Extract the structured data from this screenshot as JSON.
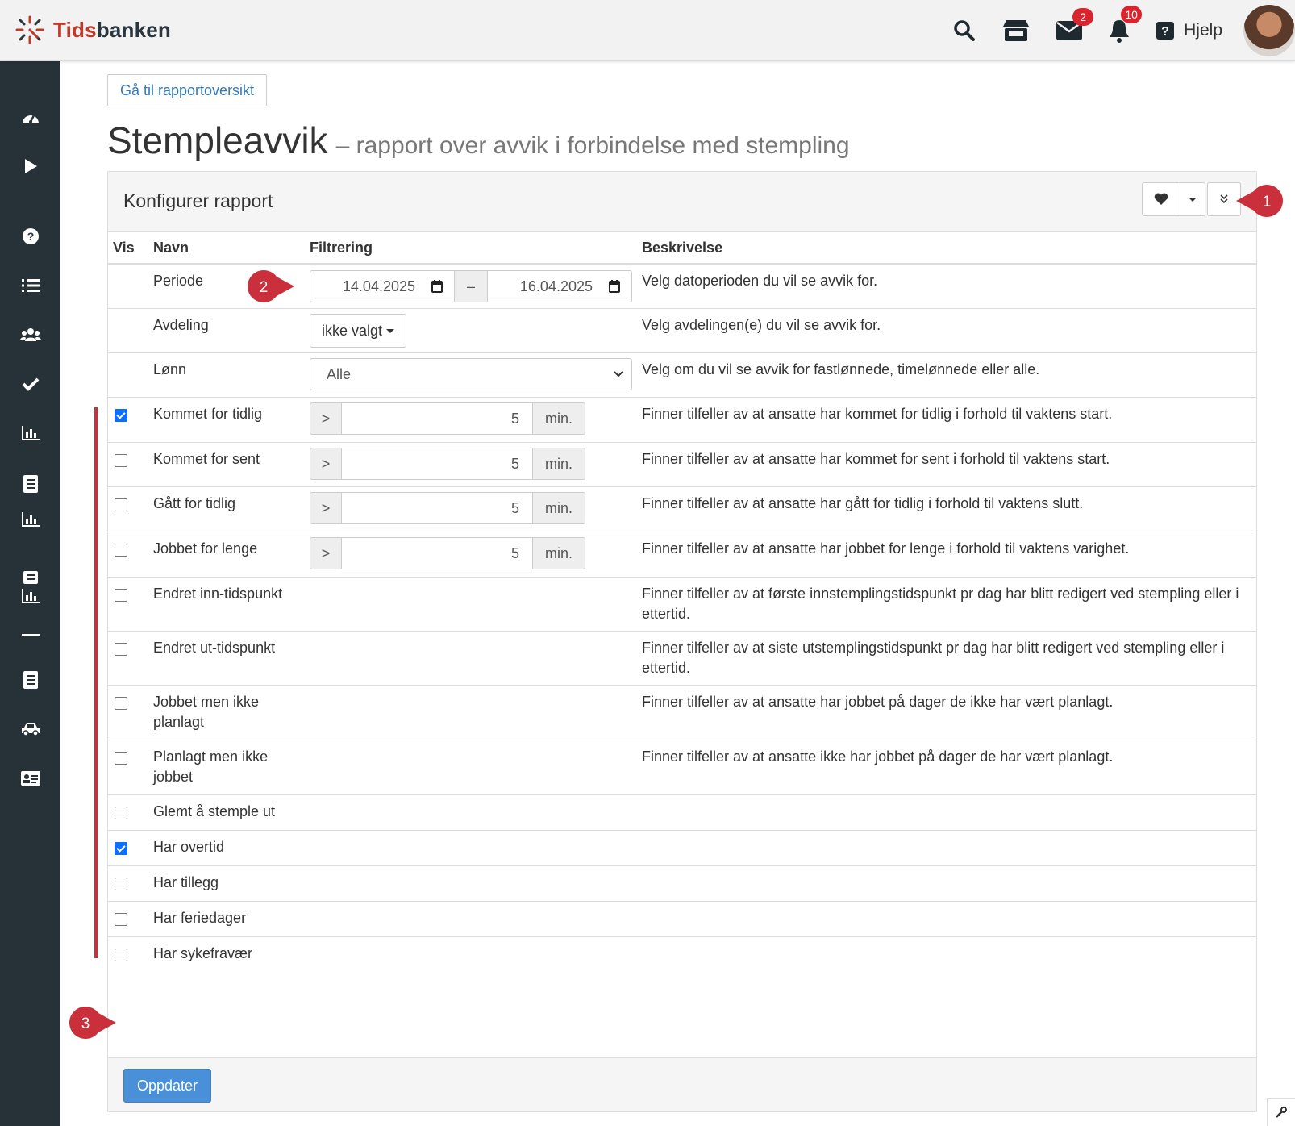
{
  "app": {
    "logo_tids": "Tids",
    "logo_banken": "banken"
  },
  "topbar": {
    "mail_badge": "2",
    "bell_badge": "10",
    "help_label": "Hjelp",
    "icons": [
      "search-icon",
      "store-icon",
      "envelope-icon",
      "bell-icon",
      "question-icon",
      "avatar"
    ]
  },
  "sidebar": {
    "icons": [
      "dashboard-icon",
      "play-icon",
      "question-circle-icon",
      "list-icon",
      "users-icon",
      "check-icon",
      "bar-chart-icon",
      "report-icon",
      "bar-chart-icon",
      "report-chart-icon",
      "minus-icon",
      "report-icon",
      "car-icon",
      "id-card-icon"
    ]
  },
  "main": {
    "back_button": "Gå til rapportoversikt",
    "title": "Stempleavvik",
    "subtitle": "– rapport over avvik i forbindelse med stempling"
  },
  "panel": {
    "title": "Konfigurer rapport",
    "columns": {
      "vis": "Vis",
      "name": "Navn",
      "filter": "Filtrering",
      "desc": "Beskrivelse"
    },
    "periode": {
      "label": "Periode",
      "from": "14.04.2025",
      "sep": "–",
      "to": "16.04.2025",
      "desc": "Velg datoperioden du vil se avvik for."
    },
    "avdeling": {
      "label": "Avdeling",
      "value": "ikke valgt",
      "desc": "Velg avdelingen(e) du vil se avvik for."
    },
    "lonn": {
      "label": "Lønn",
      "value": "Alle",
      "desc": "Velg om du vil se avvik for fastlønnede, timelønnede eller alle."
    },
    "rows": [
      {
        "checked": true,
        "name": "Kommet for tidlig",
        "op": ">",
        "value": "5",
        "unit": "min.",
        "desc": "Finner tilfeller av at ansatte har kommet for tidlig i forhold til vaktens start."
      },
      {
        "checked": false,
        "name": "Kommet for sent",
        "op": ">",
        "value": "5",
        "unit": "min.",
        "desc": "Finner tilfeller av at ansatte har kommet for sent i forhold til vaktens start."
      },
      {
        "checked": false,
        "name": "Gått for tidlig",
        "op": ">",
        "value": "5",
        "unit": "min.",
        "desc": "Finner tilfeller av at ansatte har gått for tidlig i forhold til vaktens slutt."
      },
      {
        "checked": false,
        "name": "Jobbet for lenge",
        "op": ">",
        "value": "5",
        "unit": "min.",
        "desc": "Finner tilfeller av at ansatte har jobbet for lenge i forhold til vaktens varighet."
      },
      {
        "checked": false,
        "name": "Endret inn-tidspunkt",
        "desc": "Finner tilfeller av at første innstemplingstidspunkt pr dag har blitt redigert ved stempling eller i ettertid."
      },
      {
        "checked": false,
        "name": "Endret ut-tidspunkt",
        "desc": "Finner tilfeller av at siste utstemplingstidspunkt pr dag har blitt redigert ved stempling eller i ettertid."
      },
      {
        "checked": false,
        "name": "Jobbet men ikke planlagt",
        "desc": "Finner tilfeller av at ansatte har jobbet på dager de ikke har vært planlagt."
      },
      {
        "checked": false,
        "name": "Planlagt men ikke jobbet",
        "desc": "Finner tilfeller av at ansatte ikke har jobbet på dager de har vært planlagt."
      },
      {
        "checked": false,
        "name": "Glemt å stemple ut",
        "desc": ""
      },
      {
        "checked": true,
        "name": "Har overtid",
        "desc": ""
      },
      {
        "checked": false,
        "name": "Har tillegg",
        "desc": ""
      },
      {
        "checked": false,
        "name": "Har feriedager",
        "desc": ""
      },
      {
        "checked": false,
        "name": "Har sykefravær",
        "desc": ""
      }
    ],
    "update_button": "Oppdater"
  },
  "annotations": {
    "m1": "1",
    "m2": "2",
    "m3": "3"
  },
  "colors": {
    "sidebar": "#263238",
    "accent": "#4a90d9",
    "marker": "#c9303c",
    "brand_red": "#c0392b"
  }
}
